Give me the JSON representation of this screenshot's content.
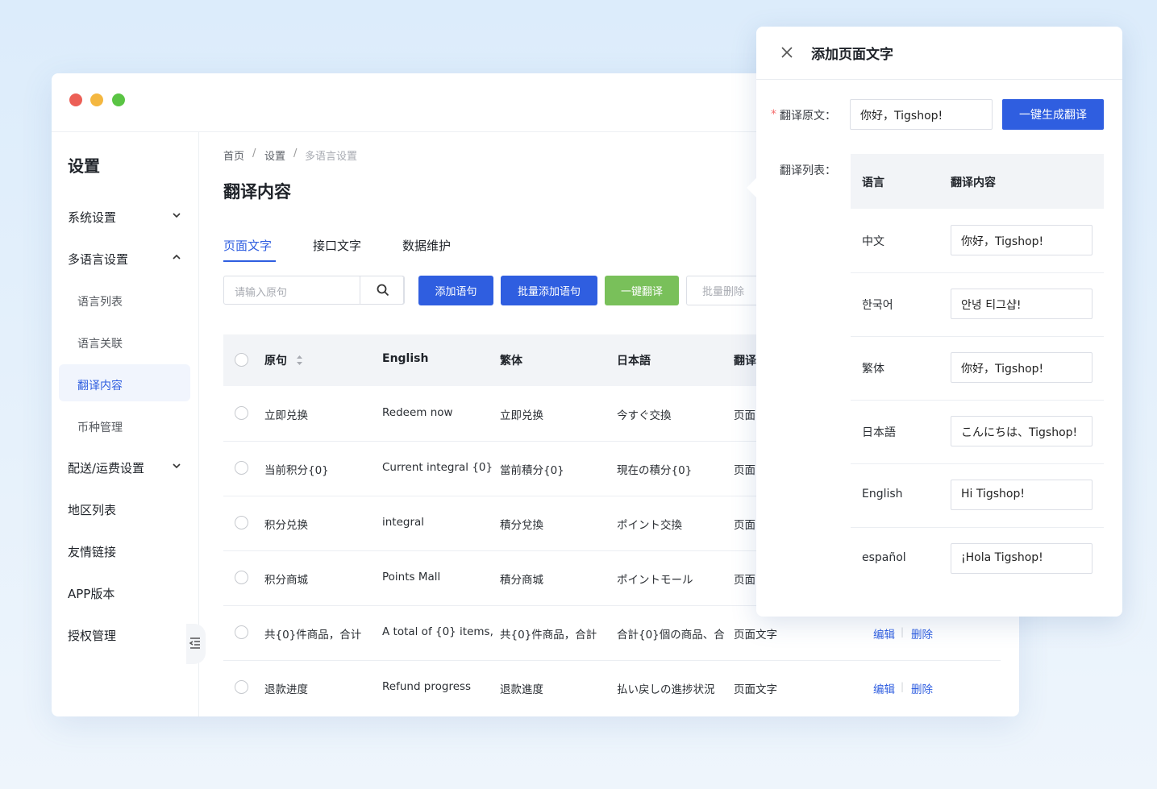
{
  "colors": {
    "primary": "#2f5ee0",
    "success": "#79c05a",
    "dot_red": "#ec5f56",
    "dot_yellow": "#f4b740",
    "dot_green": "#5ac444"
  },
  "sidebar": {
    "title": "设置",
    "items": [
      {
        "label": "系统设置",
        "chevron": "chevron-down-icon"
      },
      {
        "label": "多语言设置",
        "chevron": "chevron-up-icon"
      },
      {
        "label": "语言列表"
      },
      {
        "label": "语言关联"
      },
      {
        "label": "翻译内容",
        "active": true
      },
      {
        "label": "币种管理"
      },
      {
        "label": "配送/运费设置",
        "chevron": "chevron-down-icon"
      },
      {
        "label": "地区列表"
      },
      {
        "label": "友情链接"
      },
      {
        "label": "APP版本"
      },
      {
        "label": "授权管理"
      }
    ]
  },
  "breadcrumb": [
    "首页",
    "/",
    "设置",
    "/",
    "多语言设置"
  ],
  "page_title": "翻译内容",
  "tabs": [
    {
      "label": "页面文字",
      "active": true
    },
    {
      "label": "接口文字"
    },
    {
      "label": "数据维护"
    }
  ],
  "toolbar": {
    "search_placeholder": "请输入原句",
    "add": "添加语句",
    "batch_add": "批量添加语句",
    "one_click": "一键翻译",
    "batch_delete": "批量删除"
  },
  "table": {
    "headers": [
      "原句",
      "English",
      "繁体",
      "日本語",
      "翻译"
    ],
    "rows": [
      [
        "立即兑换",
        "Redeem now",
        "立即兑换",
        "今すぐ交換",
        "页面"
      ],
      [
        "当前积分{0}",
        "Current integral {0}",
        "當前積分{0}",
        "現在の積分{0}",
        "页面"
      ],
      [
        "积分兑换",
        "integral",
        "積分兌換",
        "ポイント交換",
        "页面"
      ],
      [
        "积分商城",
        "Points Mall",
        "積分商城",
        "ポイントモール",
        "页面"
      ],
      [
        "共{0}件商品，合计",
        "A total of {0} items,",
        "共{0}件商品，合計",
        "合計{0}個の商品、合",
        "页面文字"
      ],
      [
        "退款进度",
        "Refund progress",
        "退款進度",
        "払い戻しの進捗状況",
        "页面文字"
      ]
    ],
    "edit": "编辑",
    "delete": "删除",
    "separator": "|"
  },
  "panel": {
    "title": "添加页面文字",
    "required_mark": "*",
    "source_label": "翻译原文：",
    "source_value": "你好，Tigshop!",
    "generate": "一键生成翻译",
    "list_label": "翻译列表：",
    "col_lang": "语言",
    "col_content": "翻译内容",
    "rows": [
      {
        "lang": "中文",
        "value": "你好，Tigshop!"
      },
      {
        "lang": "한국어",
        "value": "안녕 티그샵!"
      },
      {
        "lang": "繁体",
        "value": "你好，Tigshop!"
      },
      {
        "lang": "日本語",
        "value": "こんにちは、Tigshop!"
      },
      {
        "lang": "English",
        "value": "Hi Tigshop!"
      },
      {
        "lang": "español",
        "value": "¡Hola Tigshop!"
      }
    ]
  }
}
